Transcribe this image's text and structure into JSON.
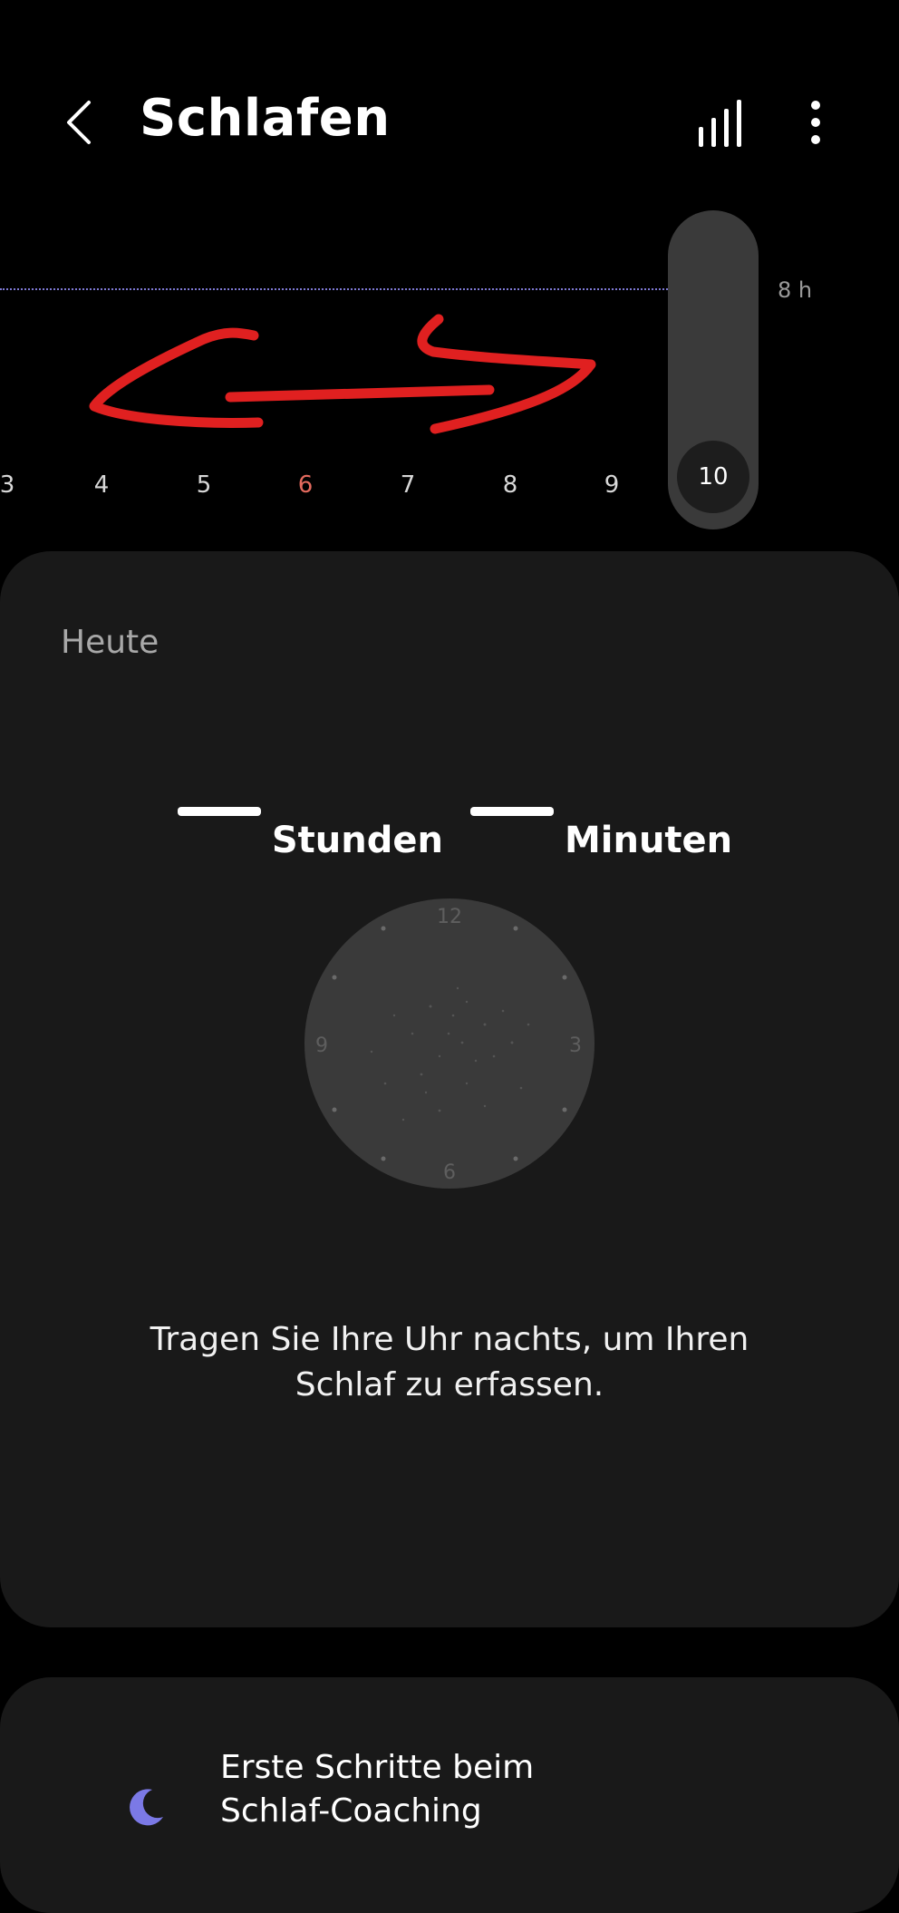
{
  "header": {
    "title": "Schlafen",
    "back_icon": "chevron-left-icon",
    "stats_icon": "bar-chart-icon",
    "more_icon": "more-vertical-icon"
  },
  "chart": {
    "goal_label": "8 h",
    "days": [
      "3",
      "4",
      "5",
      "6",
      "7",
      "8",
      "9"
    ],
    "today_day": "6",
    "selected_day": "10",
    "goal_line_color": "#7f7ad6",
    "today_color": "#e46a5e",
    "annotation_color": "#e02020"
  },
  "today_card": {
    "label": "Heute",
    "hours_unit": "Stunden",
    "minutes_unit": "Minuten",
    "clock_numbers": {
      "n12": "12",
      "n3": "3",
      "n6": "6",
      "n9": "9"
    },
    "hint_line1": "Tragen Sie Ihre Uhr nachts, um Ihren",
    "hint_line2": "Schlaf zu erfassen."
  },
  "coach_card": {
    "icon": "moon-icon",
    "line1": "Erste Schritte beim",
    "line2": "Schlaf-Coaching"
  }
}
